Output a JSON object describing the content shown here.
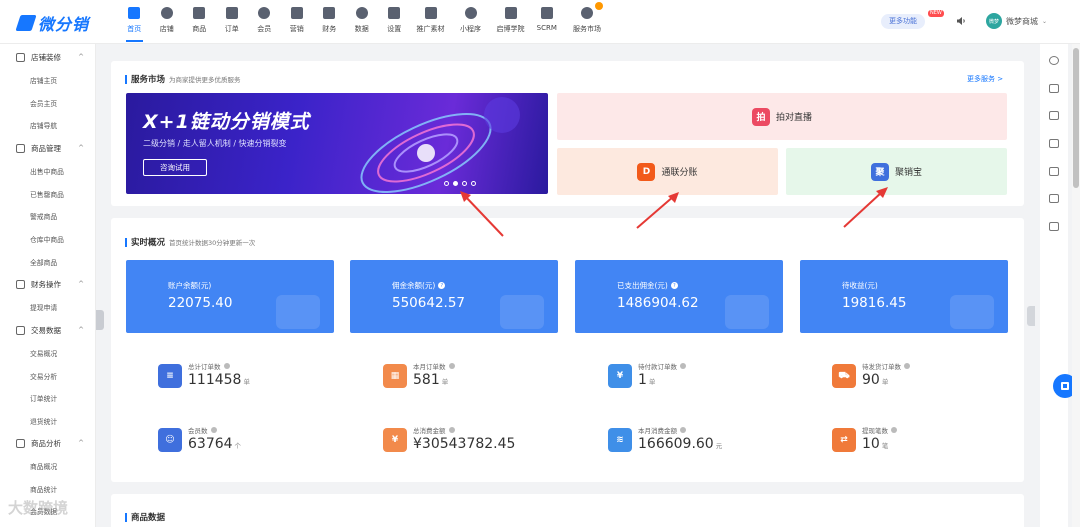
{
  "logo": {
    "text": "微分销"
  },
  "topnav": [
    {
      "label": "首页",
      "active": true
    },
    {
      "label": "店铺"
    },
    {
      "label": "商品"
    },
    {
      "label": "订单"
    },
    {
      "label": "会员"
    },
    {
      "label": "营销"
    },
    {
      "label": "财务"
    },
    {
      "label": "数据"
    },
    {
      "label": "设置"
    },
    {
      "label": "推广素材"
    },
    {
      "label": "小程序"
    },
    {
      "label": "启博学院"
    },
    {
      "label": "SCRM"
    },
    {
      "label": "服务市场"
    }
  ],
  "header": {
    "more_functions": "更多功能",
    "new_badge": "NEW",
    "avatar_text": "微梦",
    "shop_name": "微梦商城"
  },
  "sidebar": {
    "groups": [
      {
        "label": "店铺装修",
        "items": [
          "店铺主页",
          "会员主页",
          "店铺导航"
        ]
      },
      {
        "label": "商品管理",
        "items": [
          "出售中商品",
          "已售罄商品",
          "警戒商品",
          "仓库中商品",
          "全部商品"
        ]
      },
      {
        "label": "财务操作",
        "items": [
          "提现申请"
        ]
      },
      {
        "label": "交易数据",
        "items": [
          "交易概况",
          "交易分析",
          "订单统计",
          "退货统计"
        ]
      },
      {
        "label": "商品分析",
        "items": [
          "商品概况",
          "商品统计",
          "会员数据"
        ]
      }
    ]
  },
  "service_market": {
    "title": "服务市场",
    "subtitle": "为商家提供更多优质服务",
    "more": "更多服务 >",
    "banner": {
      "title": "X+1链动分销模式",
      "subtitle": "二级分销 / 走人留人机制 / 快速分销裂变",
      "button": "咨询试用"
    },
    "cards": [
      {
        "label": "拍对直播",
        "icon_char": "拍",
        "color": "#ec4a62"
      },
      {
        "label": "通联分账",
        "icon_char": "D",
        "color": "#f25a1a"
      },
      {
        "label": "聚销宝",
        "icon_char": "聚",
        "color": "#3f6fdd"
      }
    ]
  },
  "realtime": {
    "title": "实时概况",
    "subtitle": "首页统计数据30分钟更新一次",
    "boxes": [
      {
        "label": "账户余额(元)",
        "value": "22075.40",
        "help": false
      },
      {
        "label": "佣金余额(元)",
        "value": "550642.57",
        "help": true
      },
      {
        "label": "已支出佣金(元)",
        "value": "1486904.62",
        "help": true
      },
      {
        "label": "待收益(元)",
        "value": "19816.45",
        "help": false
      }
    ],
    "metrics": [
      {
        "label": "总计订单数",
        "value": "111458",
        "unit": "单",
        "color": "#3f6fdd",
        "icon_char": "≡"
      },
      {
        "label": "本月订单数",
        "value": "581",
        "unit": "单",
        "color": "#f28a4b",
        "icon_char": "▦"
      },
      {
        "label": "待付款订单数",
        "value": "1",
        "unit": "单",
        "color": "#3f8fe8",
        "icon_char": "¥"
      },
      {
        "label": "待发货订单数",
        "value": "90",
        "unit": "单",
        "color": "#f07a3a",
        "icon_char": "⛟"
      },
      {
        "label": "会员数",
        "value": "63764",
        "unit": "个",
        "color": "#3f6fdd",
        "icon_char": "☺"
      },
      {
        "label": "总消费金额",
        "value": "¥30543782.45",
        "unit": "",
        "color": "#f28a4b",
        "icon_char": "¥"
      },
      {
        "label": "本月消费金额",
        "value": "166609.60",
        "unit": "元",
        "color": "#3f8fe8",
        "icon_char": "≋"
      },
      {
        "label": "提现笔数",
        "value": "10",
        "unit": "笔",
        "color": "#f07a3a",
        "icon_char": "⇄"
      }
    ]
  },
  "goods_data": {
    "title": "商品数据"
  },
  "watermark": "大数跨境",
  "colors": {
    "accent": "#1677ff",
    "stat_blue": "#4285f4",
    "arrow": "#e53935"
  }
}
